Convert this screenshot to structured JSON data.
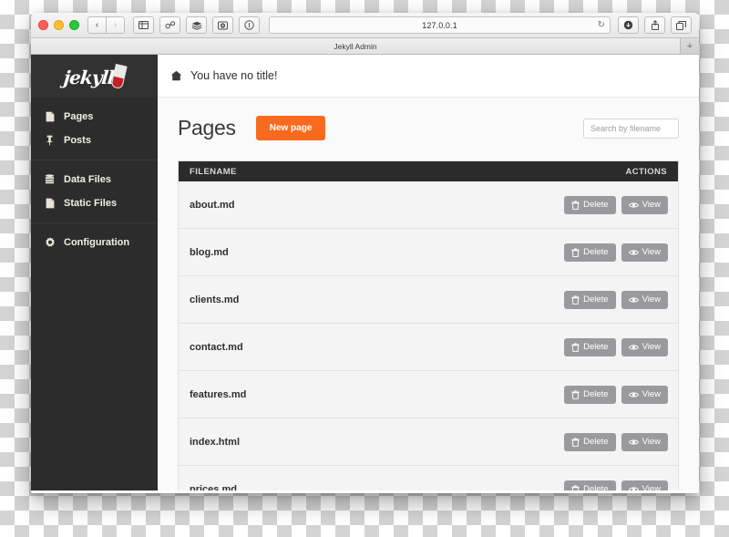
{
  "browser": {
    "url": "127.0.0.1",
    "reload_icon": "reload-icon",
    "tab_title": "Jekyll Admin",
    "new_tab_label": "+",
    "back_label": "‹",
    "forward_label": "›",
    "toolbar_icons": [
      "sidebar-icon",
      "link-icon",
      "layers-icon",
      "camera-icon",
      "info-icon"
    ],
    "right_icons": [
      "download-icon",
      "share-icon",
      "tabs-icon"
    ]
  },
  "sidebar": {
    "logo_text": "jekyll",
    "groups": [
      {
        "items": [
          {
            "label": "Pages",
            "icon": "file-icon"
          },
          {
            "label": "Posts",
            "icon": "pin-icon"
          }
        ]
      },
      {
        "items": [
          {
            "label": "Data Files",
            "icon": "database-icon"
          },
          {
            "label": "Static Files",
            "icon": "document-icon"
          }
        ]
      },
      {
        "items": [
          {
            "label": "Configuration",
            "icon": "gear-icon"
          }
        ]
      }
    ]
  },
  "breadcrumb": {
    "home_icon": "home-icon",
    "text": "You have no title!"
  },
  "main": {
    "title": "Pages",
    "new_button": "New page",
    "search_placeholder": "Search by filename"
  },
  "table": {
    "columns": [
      "FILENAME",
      "ACTIONS"
    ],
    "delete_label": "Delete",
    "view_label": "View",
    "rows": [
      {
        "filename": "about.md"
      },
      {
        "filename": "blog.md"
      },
      {
        "filename": "clients.md"
      },
      {
        "filename": "contact.md"
      },
      {
        "filename": "features.md"
      },
      {
        "filename": "index.html"
      },
      {
        "filename": "prices.md"
      }
    ]
  },
  "colors": {
    "accent": "#f96a1e",
    "sidebar": "#2c2c2c",
    "table_header": "#2b2b2b",
    "action_button": "#9a9a9e"
  }
}
